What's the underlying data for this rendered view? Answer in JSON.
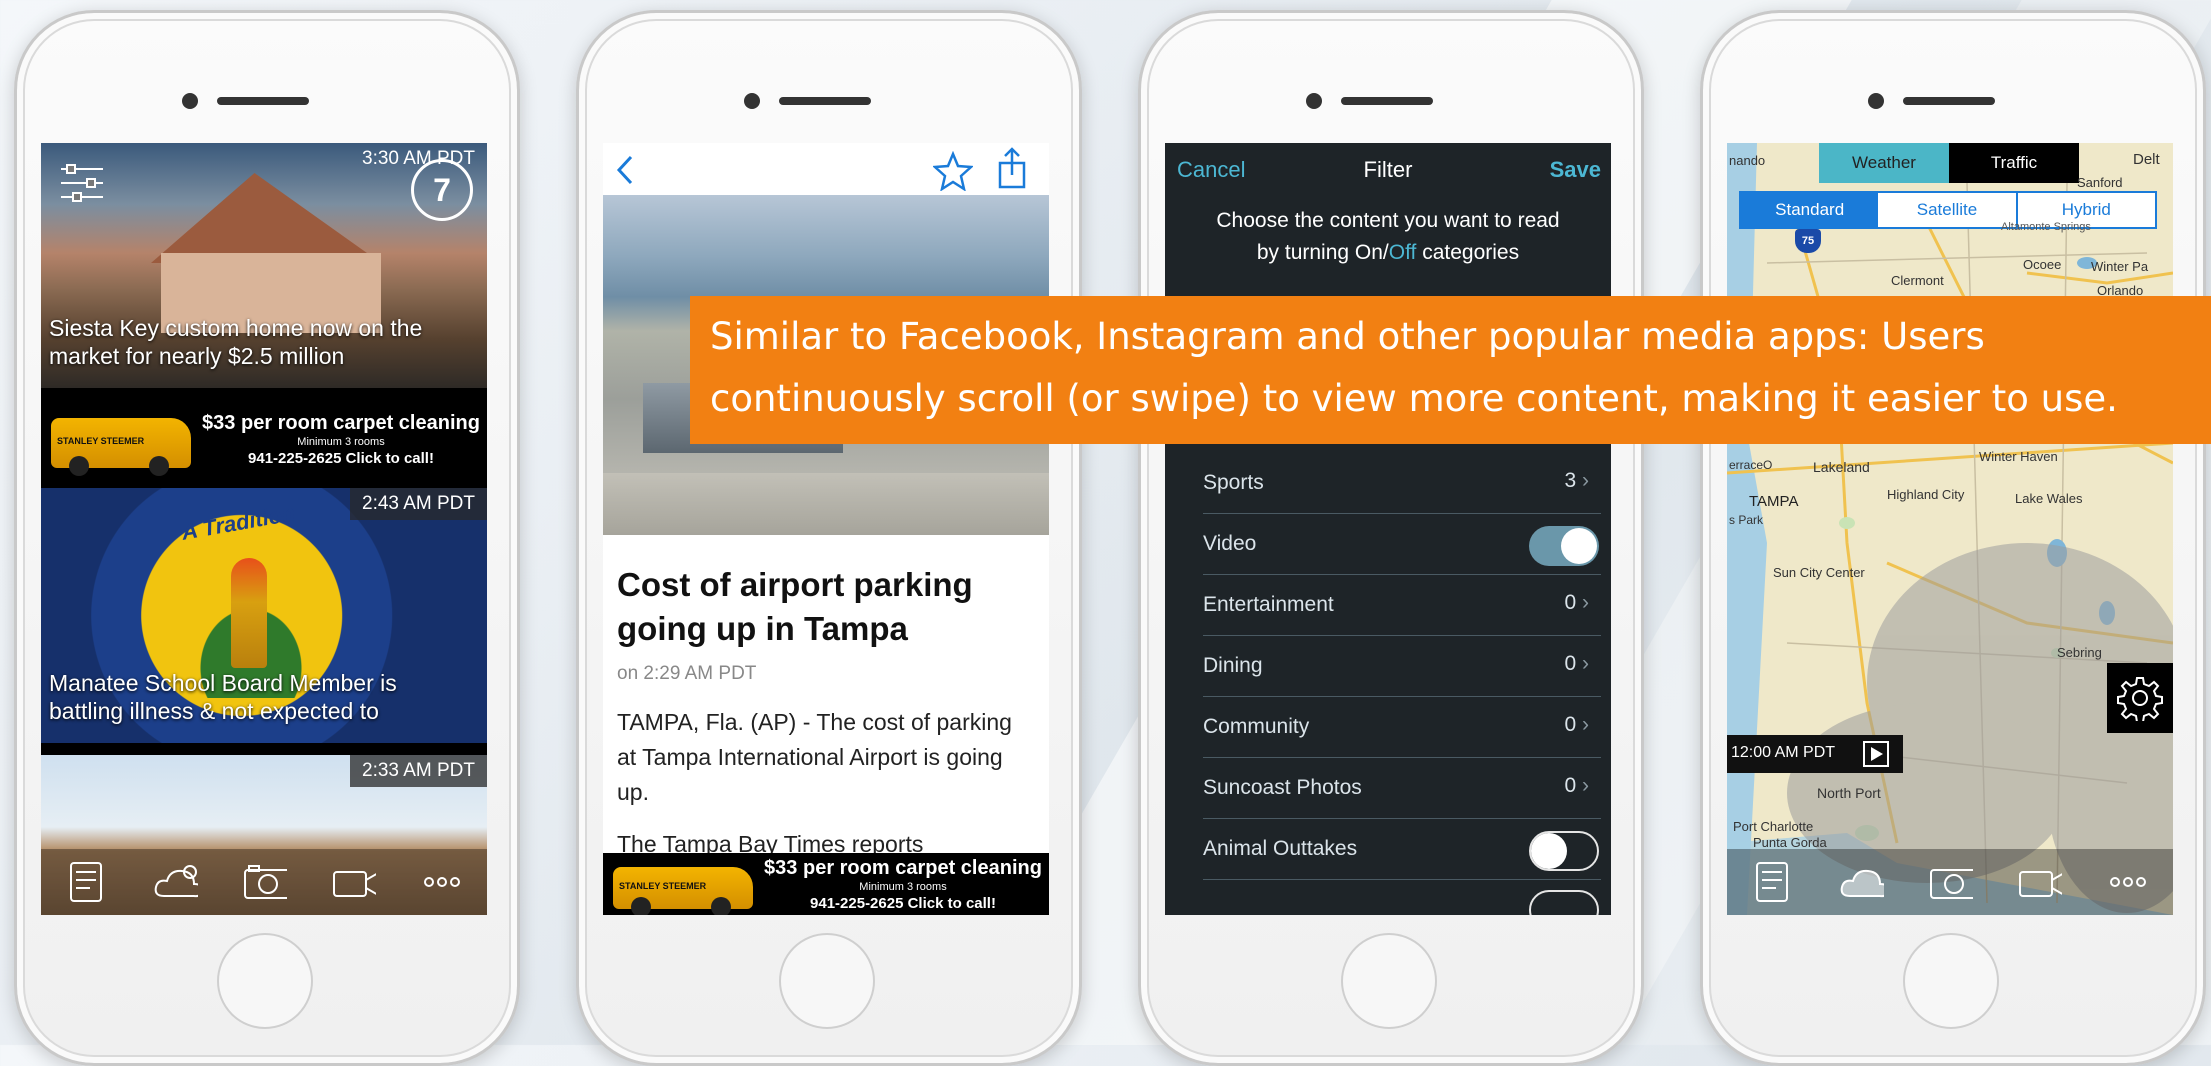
{
  "banner": {
    "line1": "Similar to Facebook, Instagram and other popular media apps: Users",
    "line2": "continuously scroll (or swipe) to view more content, making it easier to use."
  },
  "feed": {
    "items": [
      {
        "time": "3:30 AM PDT",
        "caption": "Siesta Key custom home now on the market for nearly $2.5 million"
      },
      {
        "time": "2:43 AM PDT",
        "caption": "Manatee School Board Member is battling illness & not expected to"
      },
      {
        "time": "2:33 AM PDT",
        "caption": ""
      }
    ],
    "seal_text": "A Tradition"
  },
  "ad": {
    "headline": "$33 per room carpet cleaning",
    "subline": "Minimum 3 rooms",
    "contact": "941-225-2625    Click to call!",
    "van_text": "STANLEY STEEMER"
  },
  "article": {
    "title": "Cost of airport parking going up in Tampa",
    "date": "on 2:29 AM PDT",
    "body": "TAMPA, Fla. (AP) - The cost of parking at Tampa International Airport is going up.",
    "more": "The Tampa Bay Times reports"
  },
  "filter": {
    "cancel": "Cancel",
    "title": "Filter",
    "save": "Save",
    "intro_a": "Choose the content you want to read",
    "intro_b": "by turning On/",
    "intro_off": "Off",
    "intro_c": " categories",
    "rows": [
      {
        "label": "Sports",
        "count": "3"
      },
      {
        "label": "Video",
        "toggle": "on"
      },
      {
        "label": "Entertainment",
        "count": "0"
      },
      {
        "label": "Dining",
        "count": "0"
      },
      {
        "label": "Community",
        "count": "0"
      },
      {
        "label": "Suncoast Photos",
        "count": "0"
      },
      {
        "label": "Animal Outtakes",
        "toggle": "off"
      }
    ]
  },
  "weather_map": {
    "tab_weather": "Weather",
    "tab_traffic": "Traffic",
    "map_standard": "Standard",
    "map_satellite": "Satellite",
    "map_hybrid": "Hybrid",
    "time": "12:00 AM PDT",
    "places": [
      "nando",
      "Delt",
      "Sanford",
      "Altamonte Springs",
      "Ocoee",
      "Winter Pa",
      "Clermont",
      "Orlando",
      "Lakeland",
      "Winter Haven",
      "TAMPA",
      "Highland City",
      "Lake Wales",
      "s Park",
      "Sun City Center",
      "Sebring",
      "North Port",
      "Port Charlotte",
      "Punta Gorda",
      "erraceO"
    ],
    "highway": "75"
  },
  "colors": {
    "banner": "#f28012",
    "ios_blue": "#1a7bd9",
    "filter_accent": "#4cb7d3",
    "filter_bg": "#1e2428"
  }
}
